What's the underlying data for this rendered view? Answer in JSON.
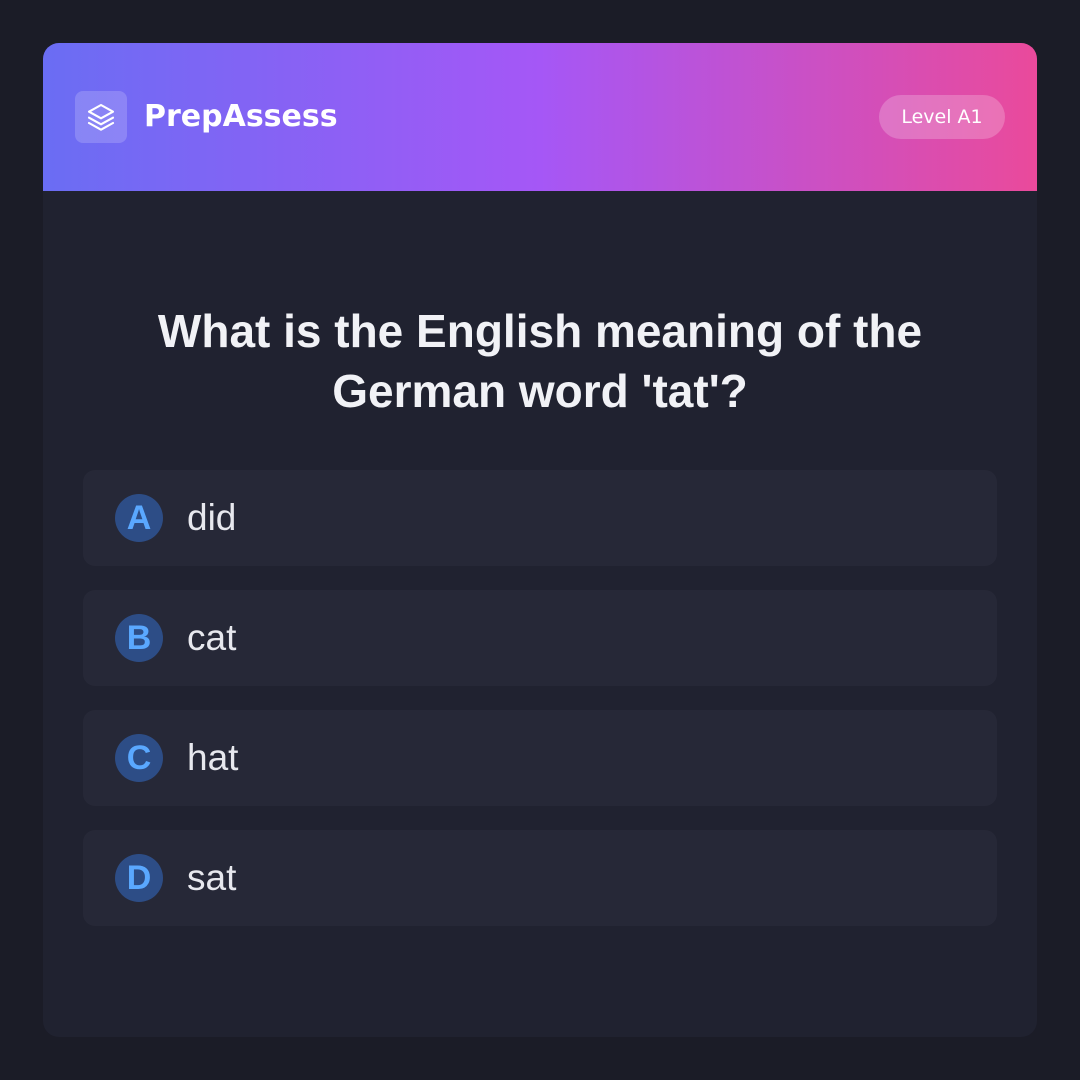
{
  "app": {
    "brand_name": "PrepAssess",
    "brand_icon": "stacked-layers-icon",
    "level_badge": "Level A1"
  },
  "question": {
    "text": "What is the English meaning of the German word 'tat'?"
  },
  "options": [
    {
      "letter": "A",
      "text": "did"
    },
    {
      "letter": "B",
      "text": "cat"
    },
    {
      "letter": "C",
      "text": "hat"
    },
    {
      "letter": "D",
      "text": "sat"
    }
  ],
  "colors": {
    "page_background": "#1b1c27",
    "card_background": "#202230",
    "header_gradient": [
      "#6a6df3",
      "#a557f6",
      "#ea4a9b"
    ],
    "option_background": "#262837",
    "option_letter_background": "#2d4d86",
    "option_letter_color": "#5aa8ff",
    "text_primary": "#f1f2f6"
  }
}
